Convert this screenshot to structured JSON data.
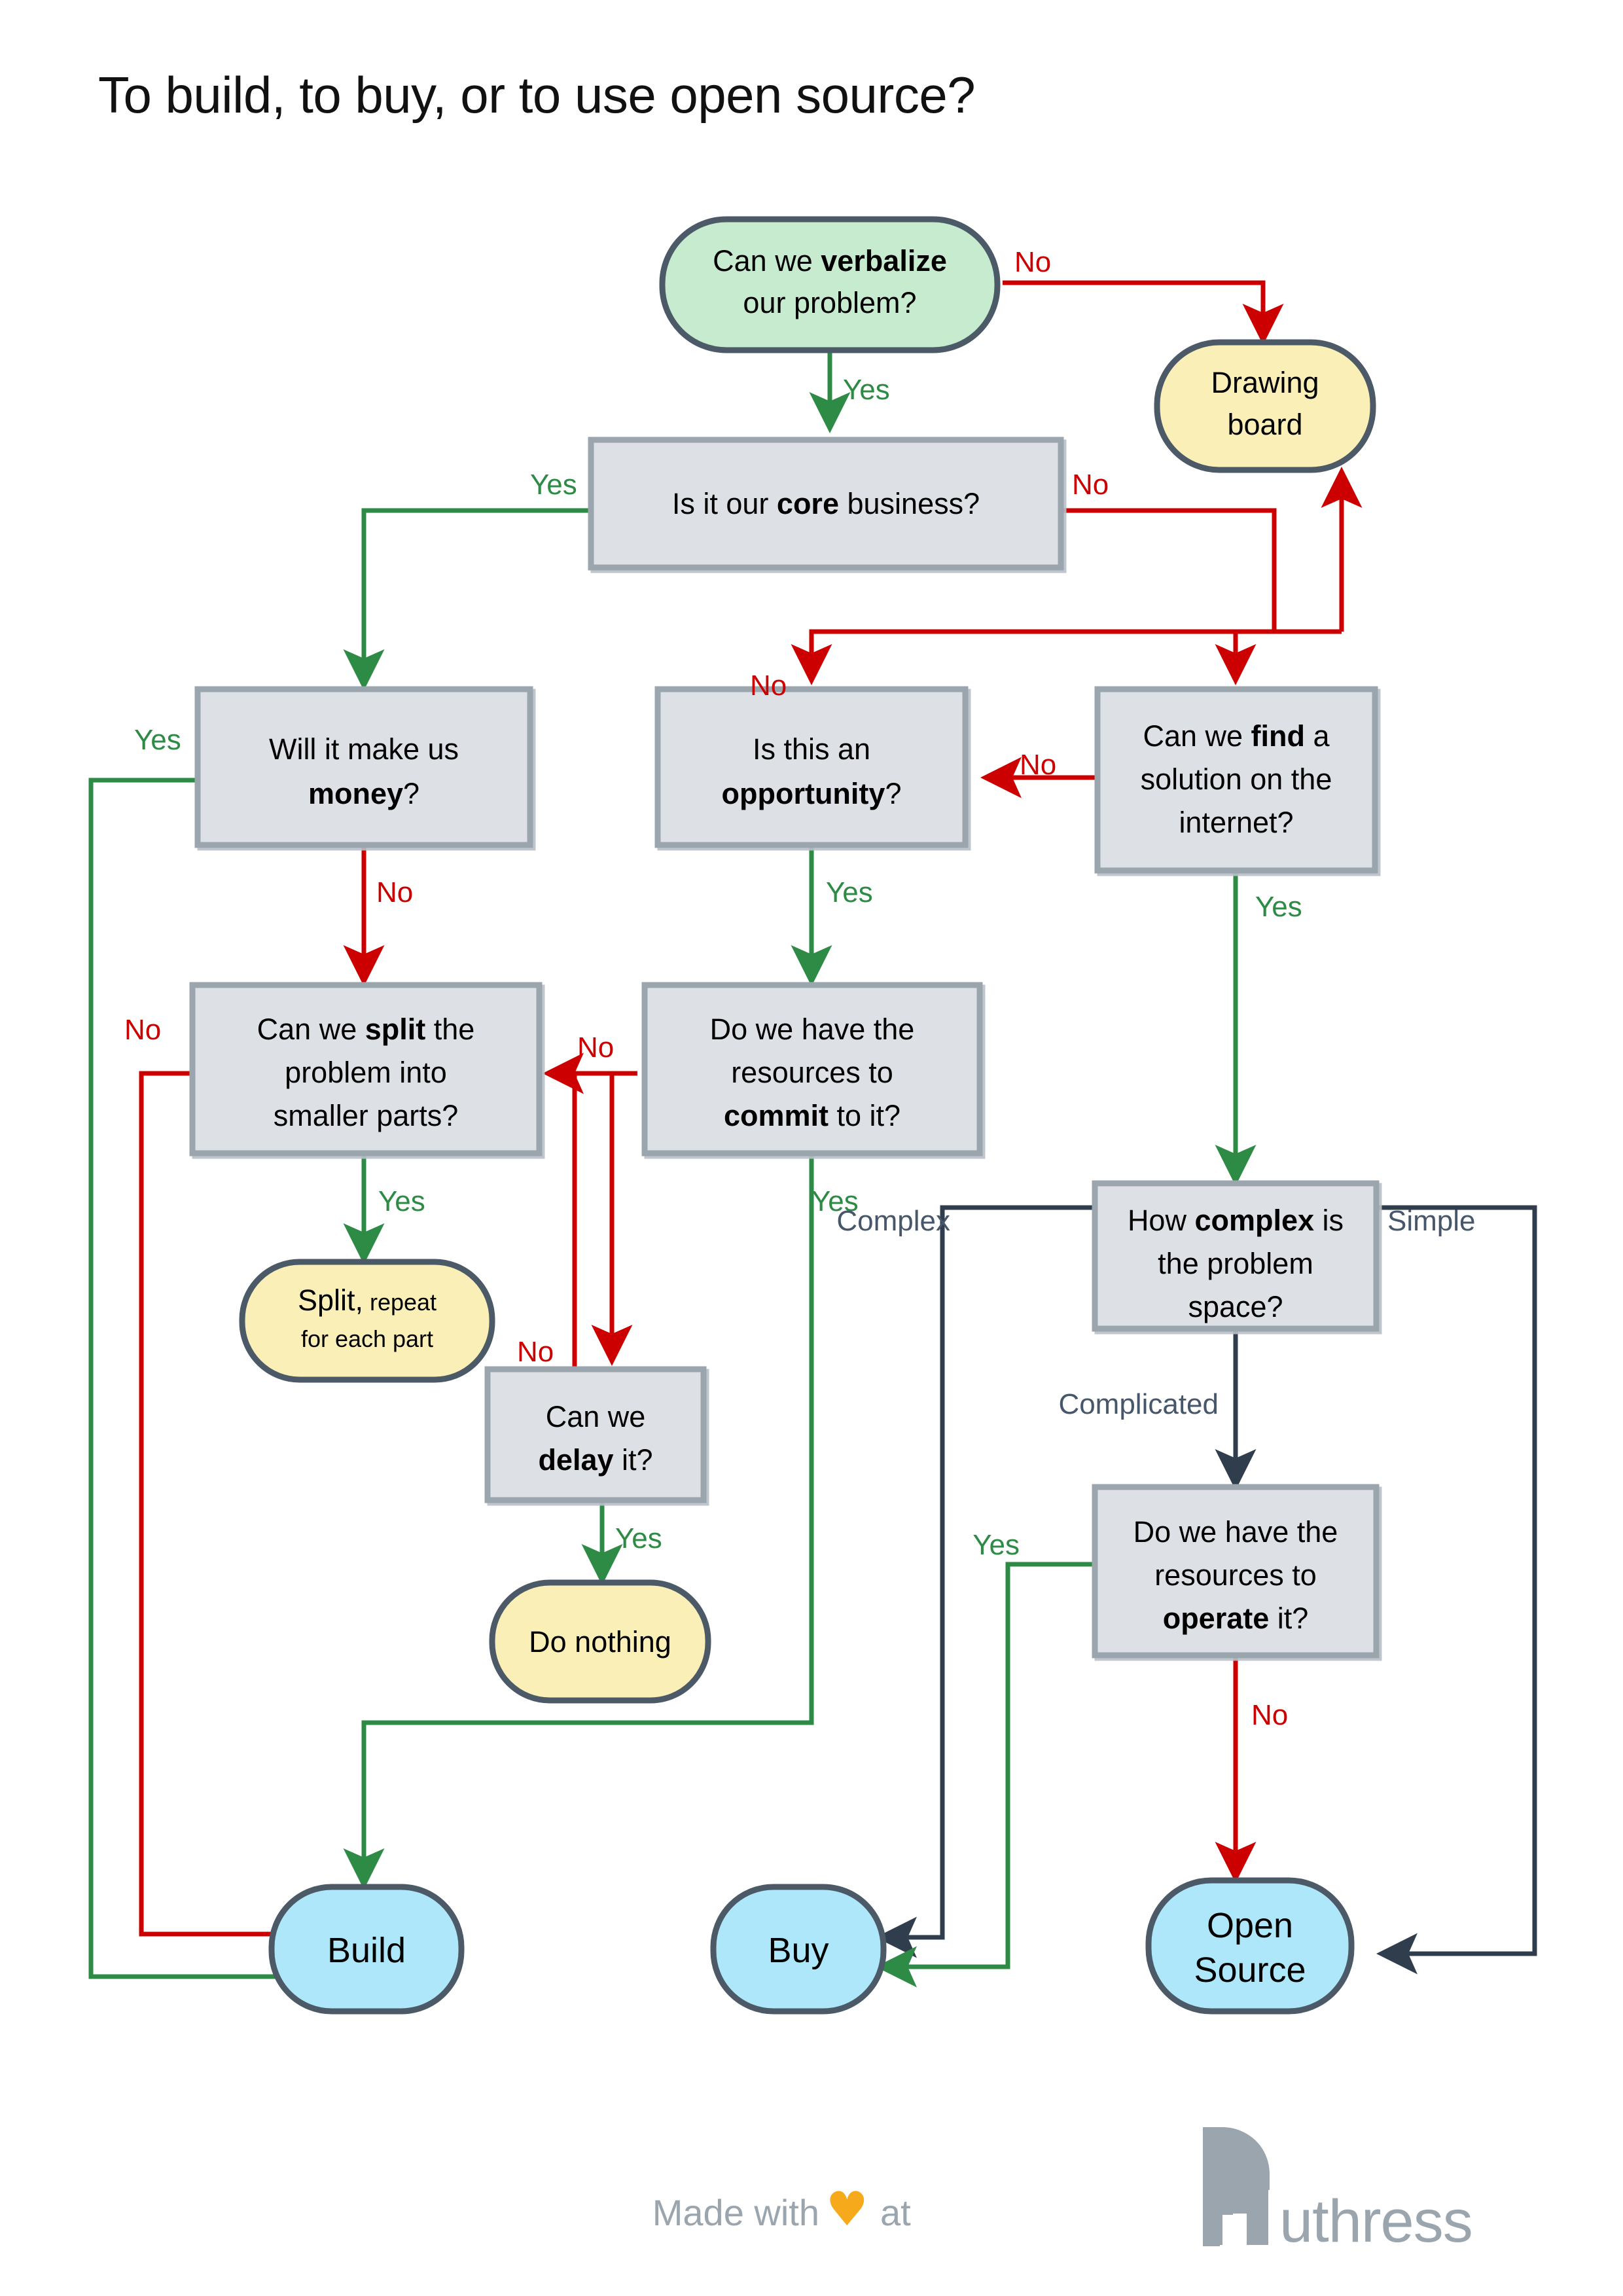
{
  "page": {
    "title": "To build, to buy, or to use open source?",
    "background": "#ffffff"
  },
  "colors": {
    "yes_green": "#2e8b45",
    "no_red": "#cc0000",
    "neutral_slate": "#2f3d4d",
    "neutral_label": "#46566b",
    "decision_fill": "#dde1e6",
    "decision_stroke": "#9aa5ae",
    "start_fill": "#c6ebce",
    "terminal_fill": "#ade7f9",
    "alt_fill": "#fbefb8",
    "rounded_stroke": "#4c5a68",
    "heart": "#f6a91b",
    "brand_gray": "#9aa5ae"
  },
  "nodes": {
    "verbalize": {
      "id": "verbalize",
      "shape": "stadium",
      "lines": [
        {
          "text": "Can we ",
          "bold": false
        },
        {
          "text": "verbalize",
          "bold": true
        }
      ],
      "line2": [
        {
          "text": "our problem?",
          "bold": false
        }
      ]
    },
    "drawing": {
      "id": "drawing",
      "shape": "stadium",
      "lines": [
        {
          "text": "Drawing",
          "bold": false
        }
      ],
      "line2": [
        {
          "text": "board",
          "bold": false
        }
      ]
    },
    "core": {
      "id": "core",
      "shape": "rect",
      "lines": [
        {
          "text": "Is it our ",
          "bold": false
        },
        {
          "text": "core",
          "bold": true
        },
        {
          "text": " business?",
          "bold": false
        }
      ]
    },
    "money": {
      "id": "money",
      "shape": "rect",
      "lines": [
        {
          "text": "Will it make us",
          "bold": false
        }
      ],
      "line2": [
        {
          "text": "money",
          "bold": true
        },
        {
          "text": "?",
          "bold": false
        }
      ]
    },
    "opportunity": {
      "id": "opportunity",
      "shape": "rect",
      "lines": [
        {
          "text": "Is this an",
          "bold": false
        }
      ],
      "line2": [
        {
          "text": "opportunity",
          "bold": true
        },
        {
          "text": "?",
          "bold": false
        }
      ]
    },
    "findsol": {
      "id": "findsol",
      "shape": "rect",
      "lines": [
        {
          "text": "Can we ",
          "bold": false
        },
        {
          "text": "find",
          "bold": true
        },
        {
          "text": " a",
          "bold": false
        }
      ],
      "line2": [
        {
          "text": "solution on the",
          "bold": false
        }
      ],
      "line3": [
        {
          "text": "internet?",
          "bold": false
        }
      ]
    },
    "split": {
      "id": "split",
      "shape": "rect",
      "lines": [
        {
          "text": "Can we ",
          "bold": false
        },
        {
          "text": "split",
          "bold": true
        },
        {
          "text": " the",
          "bold": false
        }
      ],
      "line2": [
        {
          "text": "problem into",
          "bold": false
        }
      ],
      "line3": [
        {
          "text": "smaller parts?",
          "bold": false
        }
      ]
    },
    "commit": {
      "id": "commit",
      "shape": "rect",
      "lines": [
        {
          "text": "Do we have the",
          "bold": false
        }
      ],
      "line2": [
        {
          "text": "resources to",
          "bold": false
        }
      ],
      "line3": [
        {
          "text": "commit",
          "bold": true
        },
        {
          "text": " to it?",
          "bold": false
        }
      ]
    },
    "splitrepeat": {
      "id": "splitrepeat",
      "shape": "stadium",
      "lines": [
        {
          "text": "Split,",
          "bold": false
        }
      ],
      "line2": [
        {
          "text": "for each part",
          "bold": false
        }
      ],
      "small": "repeat"
    },
    "complex": {
      "id": "complex",
      "shape": "rect",
      "lines": [
        {
          "text": "How ",
          "bold": false
        },
        {
          "text": "complex",
          "bold": true
        },
        {
          "text": " is",
          "bold": false
        }
      ],
      "line2": [
        {
          "text": "the problem",
          "bold": false
        }
      ],
      "line3": [
        {
          "text": "space?",
          "bold": false
        }
      ]
    },
    "delay": {
      "id": "delay",
      "shape": "rect",
      "lines": [
        {
          "text": "Can we",
          "bold": false
        }
      ],
      "line2": [
        {
          "text": "delay",
          "bold": true
        },
        {
          "text": " it?",
          "bold": false
        }
      ]
    },
    "operate": {
      "id": "operate",
      "shape": "rect",
      "lines": [
        {
          "text": "Do we have the",
          "bold": false
        }
      ],
      "line2": [
        {
          "text": "resources to",
          "bold": false
        }
      ],
      "line3": [
        {
          "text": "operate",
          "bold": true
        },
        {
          "text": " it?",
          "bold": false
        }
      ]
    },
    "donothing": {
      "id": "donothing",
      "shape": "stadium",
      "lines": [
        {
          "text": "Do nothing",
          "bold": false
        }
      ]
    },
    "build": {
      "id": "build",
      "shape": "terminal",
      "lines": [
        {
          "text": "Build",
          "bold": false
        }
      ]
    },
    "buy": {
      "id": "buy",
      "shape": "terminal",
      "lines": [
        {
          "text": "Buy",
          "bold": false
        }
      ]
    },
    "opensource": {
      "id": "opensource",
      "shape": "terminal",
      "lines": [
        {
          "text": "Open",
          "bold": false
        }
      ],
      "line2": [
        {
          "text": "Source",
          "bold": false
        }
      ]
    }
  },
  "node_text": {
    "verbalize_l1_a": "Can we ",
    "verbalize_l1_b": "verbalize",
    "verbalize_l2": "our problem?",
    "drawing_l1": "Drawing",
    "drawing_l2": "board",
    "core_a": "Is it our ",
    "core_b": "core",
    "core_c": " business?",
    "money_l1": "Will it make us",
    "money_l2_b": "money",
    "money_l2_c": "?",
    "opportunity_l1": "Is this an",
    "opportunity_l2_b": "opportunity",
    "opportunity_l2_c": "?",
    "findsol_l1_a": "Can we ",
    "findsol_l1_b": "find",
    "findsol_l1_c": " a",
    "findsol_l2": "solution on the",
    "findsol_l3": "internet?",
    "split_l1_a": "Can we ",
    "split_l1_b": "split",
    "split_l1_c": " the",
    "split_l2": "problem into",
    "split_l3": "smaller parts?",
    "commit_l1": "Do we have the",
    "commit_l2": "resources to",
    "commit_l3_b": "commit",
    "commit_l3_c": " to it?",
    "splitrepeat_l1_a": "Split,",
    "splitrepeat_l1_b": "repeat",
    "splitrepeat_l2": "for each part",
    "complex_l1_a": "How ",
    "complex_l1_b": "complex",
    "complex_l1_c": " is",
    "complex_l2": "the problem",
    "complex_l3": "space?",
    "delay_l1": "Can we",
    "delay_l2_b": "delay",
    "delay_l2_c": " it?",
    "operate_l1": "Do we have the",
    "operate_l2": "resources to",
    "operate_l3_b": "operate",
    "operate_l3_c": " it?",
    "donothing_l1": "Do nothing",
    "build_l1": "Build",
    "buy_l1": "Buy",
    "opensource_l1": "Open",
    "opensource_l2": "Source"
  },
  "edge_labels": {
    "verbalize_no": "No",
    "verbalize_yes": "Yes",
    "core_yes": "Yes",
    "core_no": "No",
    "core_no_2": "No",
    "money_yes": "Yes",
    "money_no": "No",
    "opportunity_yes": "Yes",
    "findsol_no": "No",
    "findsol_yes": "Yes",
    "split_no": "No",
    "split_yes": "Yes",
    "commit_no": "No",
    "commit_yes": "Yes",
    "delay_no": "No",
    "delay_yes": "Yes",
    "complex_complex": "Complex",
    "complex_simple": "Simple",
    "complex_complicated": "Complicated",
    "operate_yes": "Yes",
    "operate_no": "No"
  },
  "footer": {
    "made_with": "Made with",
    "heart": "♥",
    "at": "at",
    "brand": "uthress",
    "brand_full": "Authress"
  }
}
